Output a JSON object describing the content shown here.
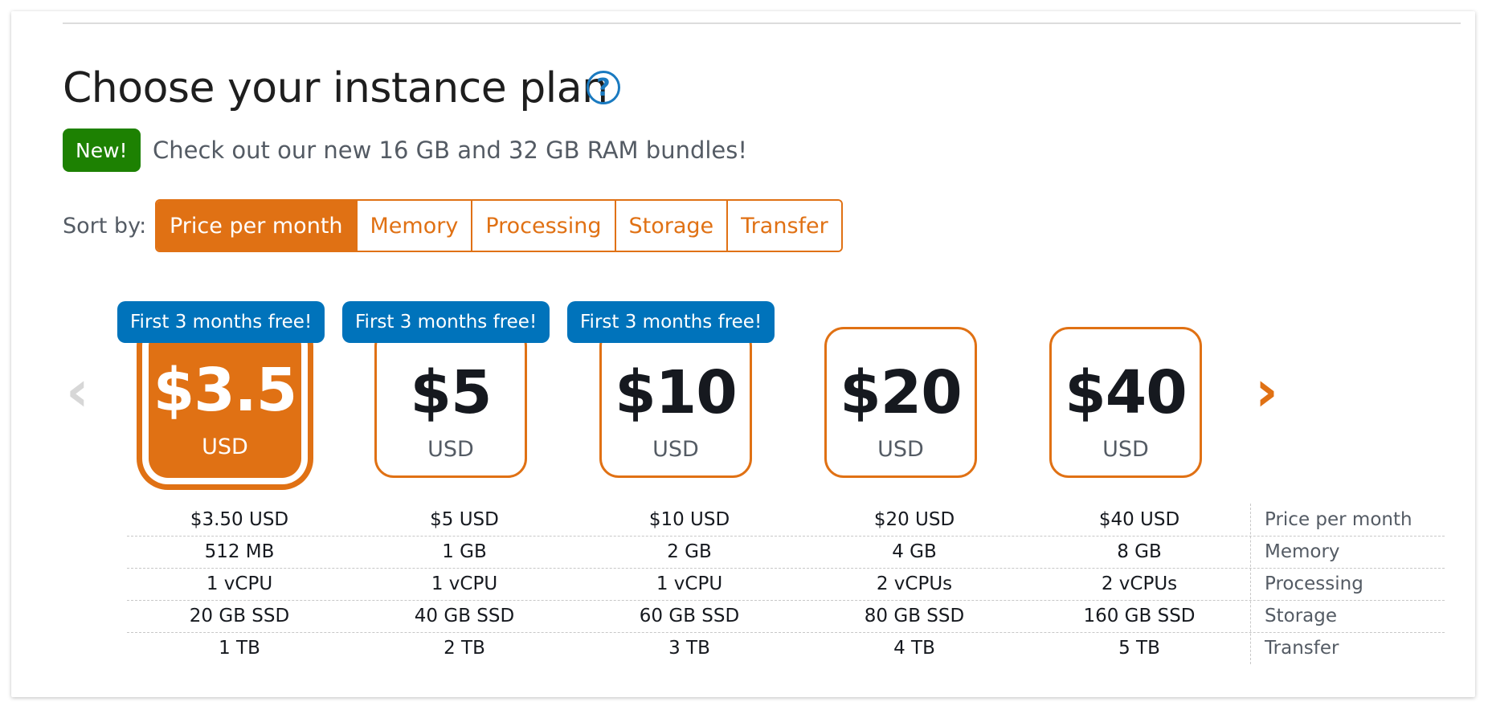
{
  "title": "Choose your instance plan",
  "help_icon": "question-circle-icon",
  "new_badge": "New!",
  "new_text": "Check out our new 16 GB and 32 GB RAM bundles!",
  "sort": {
    "label": "Sort by:",
    "options": [
      "Price per month",
      "Memory",
      "Processing",
      "Storage",
      "Transfer"
    ],
    "selected": "Price per month"
  },
  "nav": {
    "prev_icon": "chevron-left-icon",
    "next_icon": "chevron-right-icon"
  },
  "promo_text": "First 3 months free!",
  "plans": [
    {
      "price": "$3.5",
      "currency": "USD",
      "promo": "First 3 months free!",
      "selected": true
    },
    {
      "price": "$5",
      "currency": "USD",
      "promo": "First 3 months free!",
      "selected": false
    },
    {
      "price": "$10",
      "currency": "USD",
      "promo": "First 3 months free!",
      "selected": false
    },
    {
      "price": "$20",
      "currency": "USD",
      "promo": "",
      "selected": false
    },
    {
      "price": "$40",
      "currency": "USD",
      "promo": "",
      "selected": false
    }
  ],
  "spec_labels": [
    "Price per month",
    "Memory",
    "Processing",
    "Storage",
    "Transfer"
  ],
  "spec_rows": [
    [
      "$3.50 USD",
      "$5 USD",
      "$10 USD",
      "$20 USD",
      "$40 USD"
    ],
    [
      "512 MB",
      "1 GB",
      "2 GB",
      "4 GB",
      "8 GB"
    ],
    [
      "1 vCPU",
      "1 vCPU",
      "1 vCPU",
      "2 vCPUs",
      "2 vCPUs"
    ],
    [
      "20 GB SSD",
      "40 GB SSD",
      "60 GB SSD",
      "80 GB SSD",
      "160 GB SSD"
    ],
    [
      "1 TB",
      "2 TB",
      "3 TB",
      "4 TB",
      "5 TB"
    ]
  ],
  "colors": {
    "accent": "#e07114",
    "promo": "#0073bb",
    "new_badge": "#1d8102"
  }
}
